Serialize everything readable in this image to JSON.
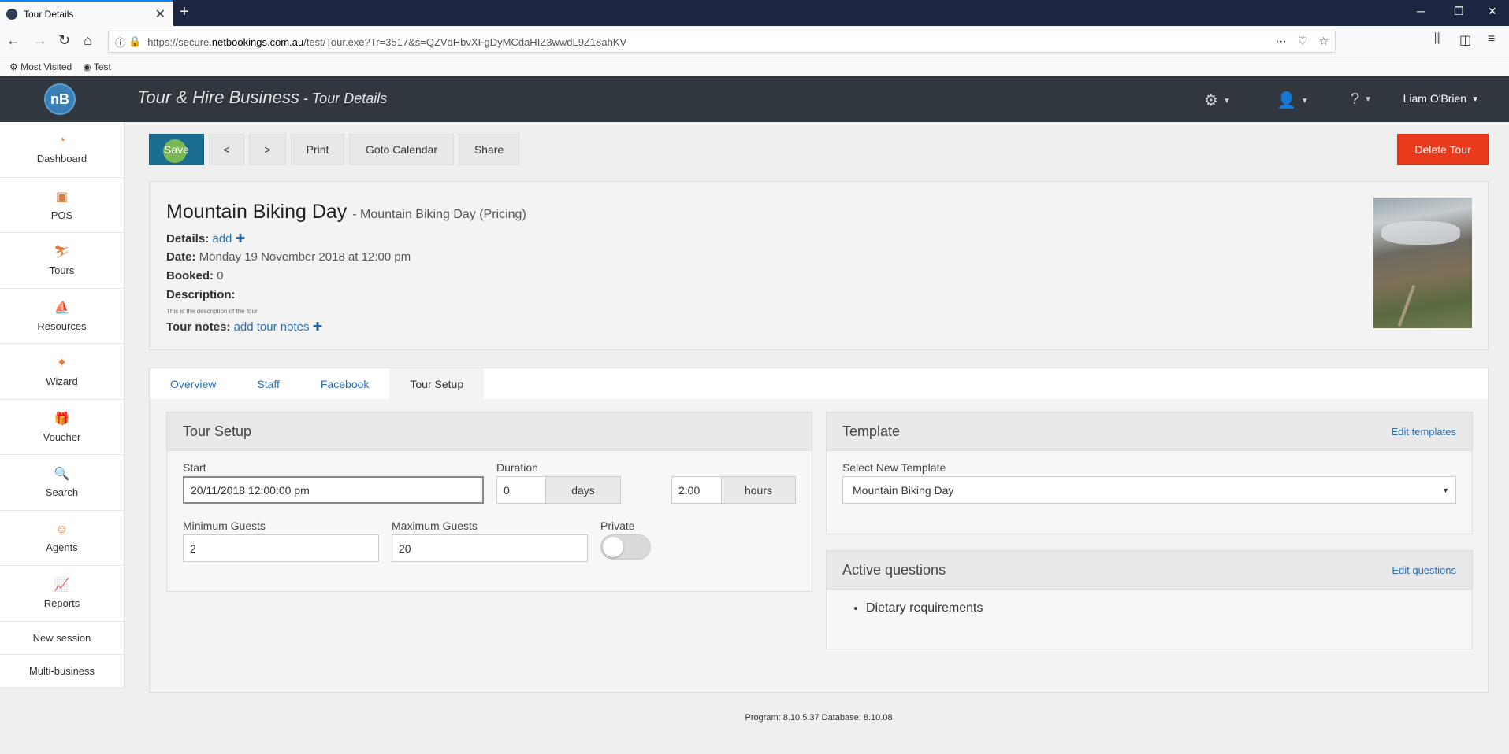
{
  "browser": {
    "tab_title": "Tour Details",
    "new_tab": "+",
    "url_prefix": "https://secure.",
    "url_domain": "netbookings.com.au",
    "url_path": "/test/Tour.exe?Tr=3517&s=QZVdHbvXFgDyMCdaHIZ3wwdL9Z18ahKV",
    "bookmarks": [
      "Most Visited",
      "Test"
    ]
  },
  "header": {
    "logo": "nB",
    "title": "Tour & Hire Business",
    "separator": " - ",
    "subtitle": "Tour Details",
    "user": "Liam O'Brien"
  },
  "sidebar": {
    "items": [
      {
        "label": "Dashboard",
        "icon": "dashboard-icon"
      },
      {
        "label": "POS",
        "icon": "pos-icon"
      },
      {
        "label": "Tours",
        "icon": "tours-icon"
      },
      {
        "label": "Resources",
        "icon": "resources-icon"
      },
      {
        "label": "Wizard",
        "icon": "wizard-icon"
      },
      {
        "label": "Voucher",
        "icon": "voucher-icon"
      },
      {
        "label": "Search",
        "icon": "search-icon"
      },
      {
        "label": "Agents",
        "icon": "agents-icon"
      },
      {
        "label": "Reports",
        "icon": "reports-icon"
      }
    ],
    "new_session": "New session",
    "multi_business": "Multi-business"
  },
  "toolbar": {
    "save": "Save",
    "prev": "<",
    "next": ">",
    "print": "Print",
    "goto_calendar": "Goto Calendar",
    "share": "Share",
    "delete_tour": "Delete Tour"
  },
  "summary": {
    "title": "Mountain Biking Day",
    "pricing": "- Mountain Biking Day (Pricing)",
    "details_label": "Details:",
    "details_link": "add",
    "date_label": "Date:",
    "date_value": "Monday 19 November 2018 at 12:00 pm",
    "booked_label": "Booked:",
    "booked_value": "0",
    "description_label": "Description:",
    "description_text": "This is the description of the tour",
    "notes_label": "Tour notes:",
    "notes_link": "add tour notes"
  },
  "tabs": [
    "Overview",
    "Staff",
    "Facebook",
    "Tour Setup"
  ],
  "tour_setup": {
    "title": "Tour Setup",
    "start_label": "Start",
    "start_value": "20/11/2018 12:00:00 pm",
    "duration_label": "Duration",
    "duration_days": "0",
    "days_label": "days",
    "duration_hours": "2:00",
    "hours_label": "hours",
    "min_guests_label": "Minimum Guests",
    "min_guests": "2",
    "max_guests_label": "Maximum Guests",
    "max_guests": "20",
    "private_label": "Private"
  },
  "template": {
    "title": "Template",
    "edit": "Edit templates",
    "select_label": "Select New Template",
    "selected": "Mountain Biking Day"
  },
  "questions": {
    "title": "Active questions",
    "edit": "Edit questions",
    "items": [
      "Dietary requirements"
    ]
  },
  "footer": "Program: 8.10.5.37 Database: 8.10.08"
}
